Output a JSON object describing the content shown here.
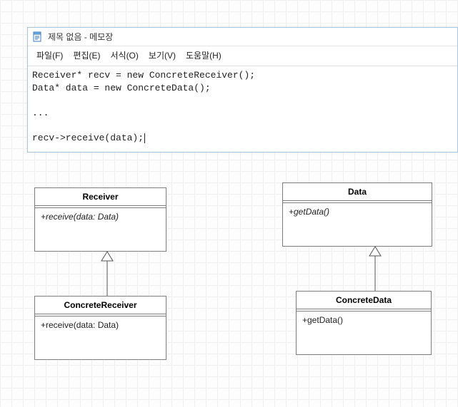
{
  "window": {
    "title": "제목 없음 - 메모장"
  },
  "menu": {
    "file": "파일(F)",
    "edit": "편집(E)",
    "format": "서식(O)",
    "view": "보기(V)",
    "help": "도움말(H)"
  },
  "editor": {
    "line1": "Receiver* recv = new ConcreteReceiver();",
    "line2": "Data* data = new ConcreteData();",
    "blank": "",
    "line3": "...",
    "line4": "recv->receive(data);"
  },
  "classes": {
    "receiver": {
      "name": "Receiver",
      "method": "+receive(data: Data)"
    },
    "concreteReceiver": {
      "name": "ConcreteReceiver",
      "method": "+receive(data: Data)"
    },
    "data": {
      "name": "Data",
      "method": "+getData()"
    },
    "concreteData": {
      "name": "ConcreteData",
      "method": "+getData()"
    }
  }
}
